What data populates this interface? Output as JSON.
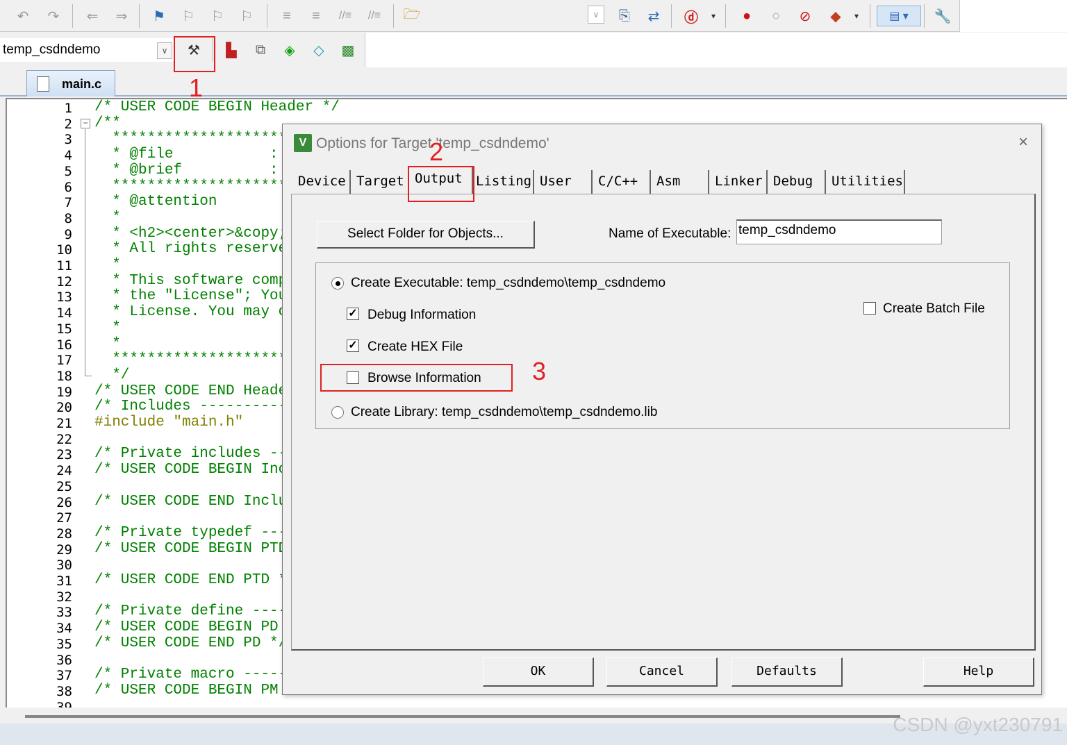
{
  "toolbar": {
    "target_name": "temp_csdndemo",
    "icons_row1": [
      "undo-icon",
      "redo-icon",
      "nav-back-icon",
      "nav-forward-icon",
      "bookmark-icon",
      "prev-bookmark-icon",
      "next-bookmark-icon",
      "clear-bookmarks-icon",
      "indent-icon",
      "unindent-icon",
      "comment-icon",
      "uncomment-icon",
      "find-in-files-icon",
      "find-icon",
      "incremental-find-icon",
      "debug-session-icon",
      "breakpoint-icon",
      "disable-breakpoint-icon",
      "kill-breakpoints-icon",
      "run-icon",
      "window-layout-icon",
      "configure-icon"
    ],
    "icons_row2": [
      "options-for-target-icon",
      "manage-project-items-icon",
      "select-packs-icon",
      "pack-installer-icon",
      "runtime-environment-icon",
      "translate-icon"
    ]
  },
  "editor": {
    "file_tab": "main.c",
    "lines": [
      {
        "n": "1",
        "t": "/* USER CODE BEGIN Header */"
      },
      {
        "n": "2",
        "t": "/**"
      },
      {
        "n": "3",
        "t": "  ********************"
      },
      {
        "n": "4",
        "t": "  * @file           : "
      },
      {
        "n": "5",
        "t": "  * @brief          : "
      },
      {
        "n": "6",
        "t": "  ********************"
      },
      {
        "n": "7",
        "t": "  * @attention"
      },
      {
        "n": "8",
        "t": "  *"
      },
      {
        "n": "9",
        "t": "  * <h2><center>&copy;"
      },
      {
        "n": "10",
        "t": "  * All rights reserve"
      },
      {
        "n": "11",
        "t": "  *"
      },
      {
        "n": "12",
        "t": "  * This software comp"
      },
      {
        "n": "13",
        "t": "  * the \"License\"; You"
      },
      {
        "n": "14",
        "t": "  * License. You may o"
      },
      {
        "n": "15",
        "t": "  *"
      },
      {
        "n": "16",
        "t": "  *"
      },
      {
        "n": "17",
        "t": "  ********************"
      },
      {
        "n": "18",
        "t": "  */"
      },
      {
        "n": "19",
        "t": "/* USER CODE END Heade"
      },
      {
        "n": "20",
        "t": "/* Includes ----------"
      },
      {
        "n": "21",
        "t": "#include \"main.h\""
      },
      {
        "n": "22",
        "t": ""
      },
      {
        "n": "23",
        "t": "/* Private includes --"
      },
      {
        "n": "24",
        "t": "/* USER CODE BEGIN Inc"
      },
      {
        "n": "25",
        "t": ""
      },
      {
        "n": "26",
        "t": "/* USER CODE END Inclu"
      },
      {
        "n": "27",
        "t": ""
      },
      {
        "n": "28",
        "t": "/* Private typedef ---"
      },
      {
        "n": "29",
        "t": "/* USER CODE BEGIN PTD"
      },
      {
        "n": "30",
        "t": ""
      },
      {
        "n": "31",
        "t": "/* USER CODE END PTD */"
      },
      {
        "n": "32",
        "t": ""
      },
      {
        "n": "33",
        "t": "/* Private define ----"
      },
      {
        "n": "34",
        "t": "/* USER CODE BEGIN PD "
      },
      {
        "n": "35",
        "t": "/* USER CODE END PD */"
      },
      {
        "n": "36",
        "t": ""
      },
      {
        "n": "37",
        "t": "/* Private macro -----"
      },
      {
        "n": "38",
        "t": "/* USER CODE BEGIN PM "
      },
      {
        "n": "39",
        "t": ""
      }
    ]
  },
  "dialog": {
    "title": "Options for Target 'temp_csdndemo'",
    "close": "×",
    "tabs": [
      "Device",
      "Target",
      "Output",
      "Listing",
      "User",
      "C/C++",
      "Asm",
      "Linker",
      "Debug",
      "Utilities"
    ],
    "active_tab": "Output",
    "select_folder_button": "Select Folder for Objects...",
    "name_of_executable_label": "Name of Executable:",
    "name_of_executable_value": "temp_csdndemo",
    "create_executable_label": "Create Executable:  temp_csdndemo\\temp_csdndemo",
    "debug_information_label": "Debug Information",
    "create_hex_label": "Create HEX File",
    "browse_information_label": "Browse Information",
    "create_batch_label": "Create Batch File",
    "create_library_label": "Create Library:  temp_csdndemo\\temp_csdndemo.lib",
    "debug_information_checked": true,
    "create_hex_checked": true,
    "browse_information_checked": false,
    "create_batch_checked": false,
    "create_executable_selected": true,
    "buttons": {
      "ok": "OK",
      "cancel": "Cancel",
      "defaults": "Defaults",
      "help": "Help"
    }
  },
  "annotations": {
    "one": "1",
    "two": "2",
    "three": "3",
    "color": "#e02020"
  },
  "watermark": "CSDN @yxt230791"
}
